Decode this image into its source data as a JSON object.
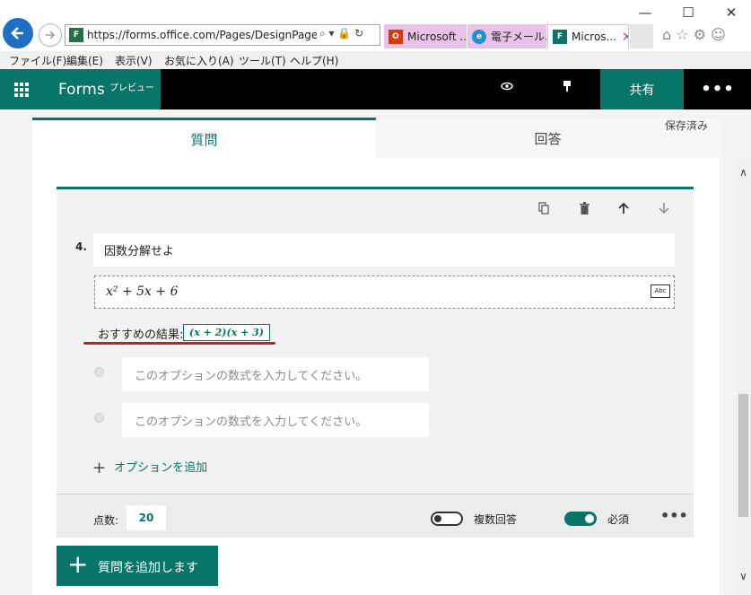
{
  "browser": {
    "url": "https://forms.office.com/Pages/DesignPage.aspx",
    "address_icons": "⌕ ▾ 🔒 ↻",
    "tabs": [
      {
        "label": "Microsoft ...",
        "icon": "office-icon"
      },
      {
        "label": "電子メール...",
        "icon": "ie-icon"
      },
      {
        "label": "Micros...",
        "icon": "forms-icon",
        "close": "×"
      }
    ],
    "menu": [
      "ファイル(F)",
      "編集(E)",
      "表示(V)",
      "お気に入り(A)",
      "ツール(T)",
      "ヘルプ(H)"
    ],
    "window_controls": {
      "minimize": "—",
      "maximize": "☐",
      "close": "✕"
    },
    "right_icons": "⌂ ☆ ⚙ ☺"
  },
  "app": {
    "name": "Forms",
    "badge": "プレビュー",
    "share": "共有",
    "more": "•••",
    "accent": "#077568"
  },
  "tabs": {
    "questions": "質問",
    "responses": "回答"
  },
  "status": "保存済み",
  "question": {
    "number": "4.",
    "title": "因数分解せよ",
    "formula": "x² + 5x + 6",
    "formula_badge": "Abc",
    "recommendation_label": "おすすめの結果:",
    "recommendation": "(x + 2)(x + 3)",
    "options": [
      {
        "placeholder": "このオプションの数式を入力してください。"
      },
      {
        "placeholder": "このオプションの数式を入力してください。"
      }
    ],
    "add_option": "オプションを追加",
    "points_label": "点数:",
    "points": "20",
    "multiple_answers": "複数回答",
    "required": "必須",
    "more": "•••"
  },
  "add_question": "質問を追加します"
}
